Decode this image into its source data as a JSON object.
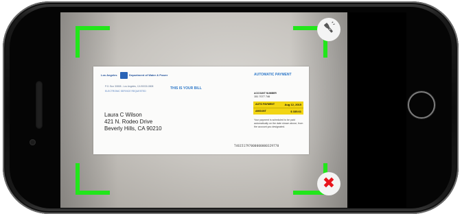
{
  "bill": {
    "logo_city": "Los Angeles",
    "logo_dept": "Department of Water & Power",
    "address_line": "P.O. Box 30808 - Los Angeles, CA 90030-0808",
    "service_line": "ELECTRONIC SERVICE REQUESTED",
    "heading": "THIS IS YOUR BILL",
    "customer": {
      "name": "Laura C Wilson",
      "street": "421 N. Rodeo Drive",
      "city": "Beverly Hills, CA  90210"
    },
    "micr_line": "T46151797000000000329770",
    "auto_payment": {
      "heading": "AUTOMATIC PAYMENT",
      "account_label": "ACCOUNT NUMBER",
      "account_number": "151 7077 746",
      "date_label": "AUTO PAYMENT",
      "date_value": "Aug 12, 2015",
      "amount_label": "AMOUNT",
      "amount_value": "$ 335.61",
      "note": "Your payment is scheduled to be paid automatically on the date shown above, from the account you designated."
    }
  },
  "controls": {
    "flash_icon": "flashlight-icon",
    "close_icon": "close-icon",
    "close_glyph": "✖"
  },
  "colors": {
    "corner_bracket": "#22e61b",
    "close_accent": "#e8141c",
    "highlight_box": "#f2d513"
  }
}
